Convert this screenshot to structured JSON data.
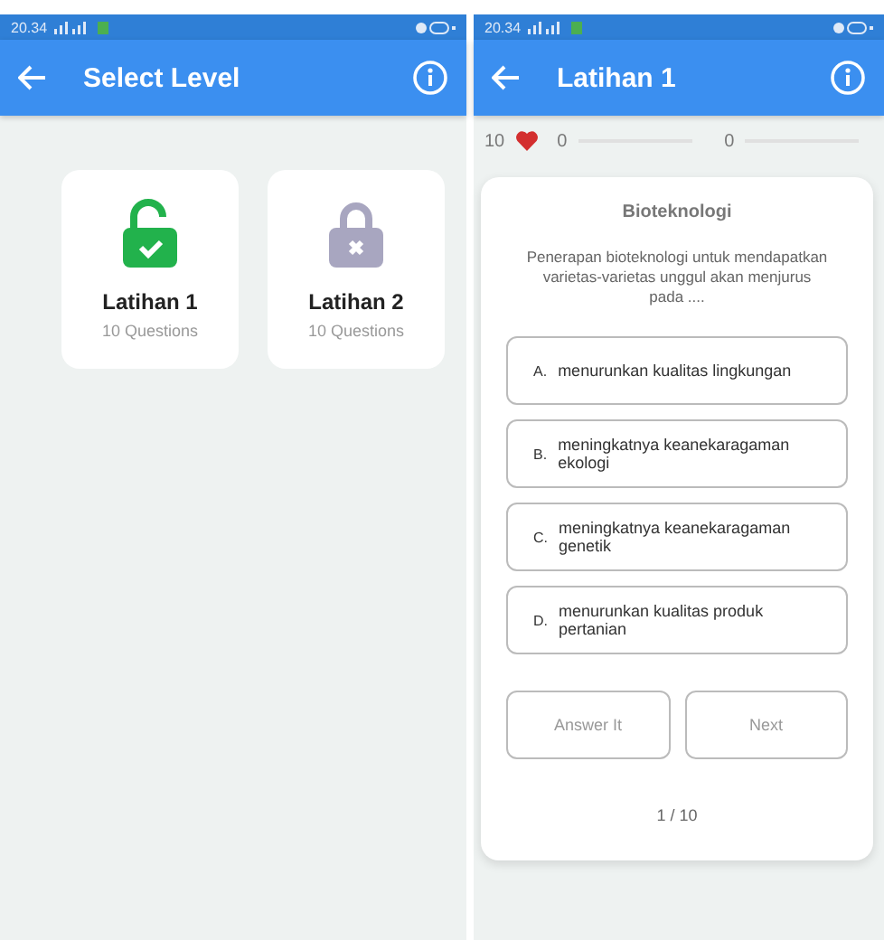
{
  "screens": [
    {
      "status_bar": {
        "time": "20.34"
      },
      "app_bar": {
        "title": "Select Level"
      },
      "levels": [
        {
          "name": "Latihan 1",
          "count": "10 Questions",
          "unlocked": true
        },
        {
          "name": "Latihan 2",
          "count": "10 Questions",
          "unlocked": false
        }
      ]
    },
    {
      "status_bar": {
        "time": "20.34"
      },
      "app_bar": {
        "title": "Latihan 1"
      }
    }
  ],
  "quiz": {
    "lives": "10",
    "scores": [
      {
        "value": "0",
        "level": 0
      },
      {
        "value": "0",
        "level": 0
      }
    ],
    "topic": "Bioteknologi",
    "question": "Penerapan bioteknologi untuk mendapatkan varietas-varietas unggul akan menjurus pada ....",
    "options": [
      {
        "letter": "A.",
        "text": "menurunkan kualitas lingkungan"
      },
      {
        "letter": "B.",
        "text": "meningkatnya keanekaragaman ekologi"
      },
      {
        "letter": "C.",
        "text": "meningkatnya keanekaragaman genetik"
      },
      {
        "letter": "D.",
        "text": "menurunkan kualitas produk pertanian"
      }
    ],
    "buttons": [
      "Answer It",
      "Next"
    ],
    "progress": "1 / 10"
  }
}
